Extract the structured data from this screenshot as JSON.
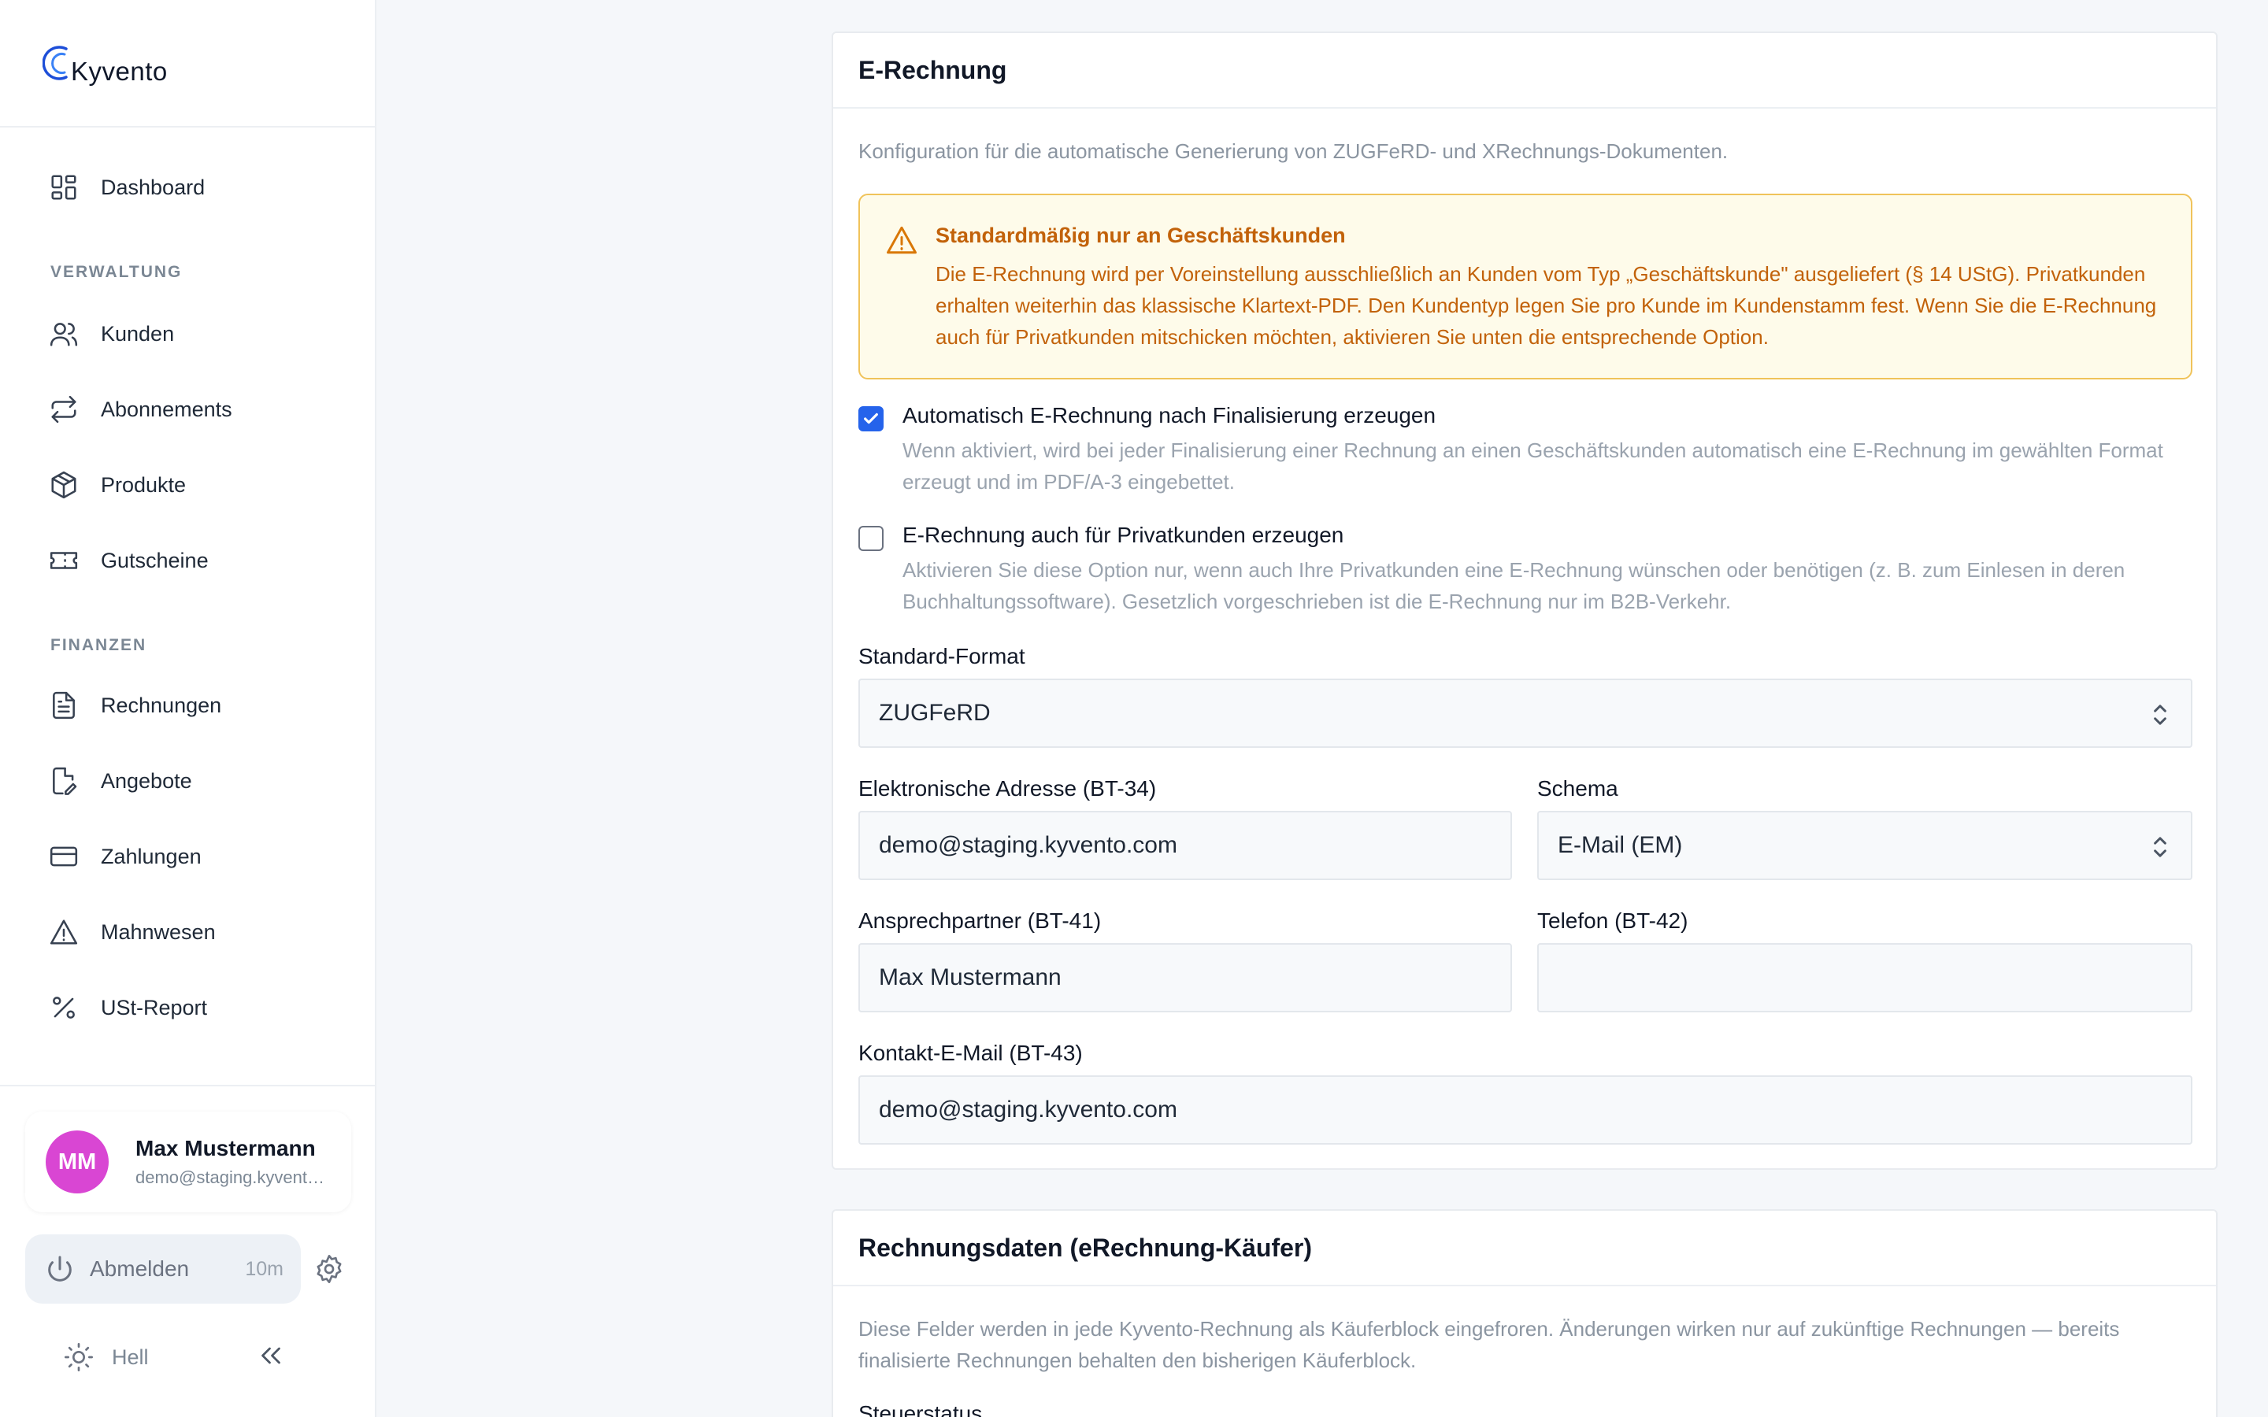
{
  "brand": {
    "name": "Kyvento"
  },
  "nav": {
    "dashboard": "Dashboard",
    "section_admin": "VERWALTUNG",
    "kunden": "Kunden",
    "abonnements": "Abonnements",
    "produkte": "Produkte",
    "gutscheine": "Gutscheine",
    "section_finance": "FINANZEN",
    "rechnungen": "Rechnungen",
    "angebote": "Angebote",
    "zahlungen": "Zahlungen",
    "mahnwesen": "Mahnwesen",
    "ust_report": "USt-Report"
  },
  "user": {
    "initials": "MM",
    "name": "Max Mustermann",
    "email": "demo@staging.kyvent…"
  },
  "session": {
    "logout_label": "Abmelden",
    "timer": "10m"
  },
  "theme": {
    "label": "Hell"
  },
  "erechnung": {
    "title": "E-Rechnung",
    "description": "Konfiguration für die automatische Generierung von ZUGFeRD- und XRechnungs-Dokumenten.",
    "alert_title": "Standardmäßig nur an Geschäftskunden",
    "alert_body": "Die E-Rechnung wird per Voreinstellung ausschließlich an Kunden vom Typ „Geschäftskunde\" ausgeliefert (§ 14 UStG). Privatkunden erhalten weiterhin das klassische Klartext-PDF. Den Kundentyp legen Sie pro Kunde im Kundenstamm fest. Wenn Sie die E-Rechnung auch für Privatkunden mitschicken möchten, aktivieren Sie unten die entsprechende Option.",
    "auto_title": "Automatisch E-Rechnung nach Finalisierung erzeugen",
    "auto_help": "Wenn aktiviert, wird bei jeder Finalisierung einer Rechnung an einen Geschäftskunden automatisch eine E-Rechnung im gewählten Format erzeugt und im PDF/A-3 eingebettet.",
    "private_title": "E-Rechnung auch für Privatkunden erzeugen",
    "private_help": "Aktivieren Sie diese Option nur, wenn auch Ihre Privatkunden eine E-Rechnung wünschen oder benötigen (z. B. zum Einlesen in deren Buchhaltungssoftware). Gesetzlich vorgeschrieben ist die E-Rechnung nur im B2B-Verkehr.",
    "format_label": "Standard-Format",
    "format_value": "ZUGFeRD",
    "address_label": "Elektronische Adresse (BT-34)",
    "address_value": "demo@staging.kyvento.com",
    "schema_label": "Schema",
    "schema_value": "E-Mail (EM)",
    "contact_label": "Ansprechpartner (BT-41)",
    "contact_value": "Max Mustermann",
    "phone_label": "Telefon (BT-42)",
    "phone_value": "",
    "contact_email_label": "Kontakt-E-Mail (BT-43)",
    "contact_email_value": "demo@staging.kyvento.com"
  },
  "buyer": {
    "title": "Rechnungsdaten (eRechnung-Käufer)",
    "description": "Diese Felder werden in jede Kyvento-Rechnung als Käuferblock eingefroren. Änderungen wirken nur auf zukünftige Rechnungen — bereits finalisierte Rechnungen behalten den bisherigen Käuferblock.",
    "next_label": "Steuerstatus"
  },
  "colors": {
    "accent": "#2563eb",
    "avatar": "#d946d3",
    "warning": "#c2620a"
  }
}
